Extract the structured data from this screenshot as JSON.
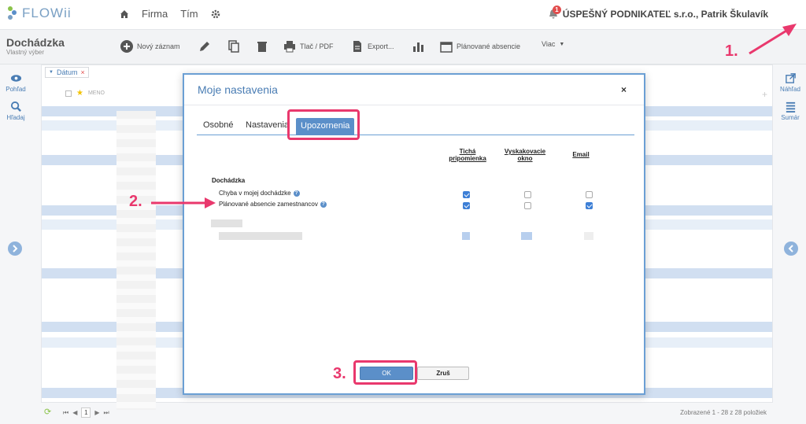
{
  "app": {
    "name": "FLOWii"
  },
  "nav": {
    "items": [
      "Firma",
      "Tím"
    ]
  },
  "header": {
    "company": "ÚSPEŠNÝ PODNIKATEĽ s.r.o., Patrik Škulavík",
    "notification_count": "1"
  },
  "page": {
    "title": "Dochádzka",
    "subtitle": "Vlastný výber"
  },
  "toolbar": {
    "new_record": "Nový záznam",
    "print": "Tlač / PDF",
    "export": "Export...",
    "planned_absences": "Plánované absencie",
    "more": "Viac"
  },
  "leftnav": {
    "view": "Pohľad",
    "search": "Hľadaj"
  },
  "rightnav": {
    "preview": "Náhľad",
    "summary": "Sumár"
  },
  "grid": {
    "filter_chip": "Dátum",
    "name_column": "MENO"
  },
  "footer": {
    "page": "1",
    "count_text": "Zobrazené 1 - 28 z 28 položiek"
  },
  "dialog": {
    "title": "Moje nastavenia",
    "close": "×",
    "tabs": [
      {
        "label": "Osobné",
        "active": false
      },
      {
        "label": "Nastavenia",
        "active": false
      },
      {
        "label": "Upozornenia",
        "active": true
      }
    ],
    "columns": [
      "Tichá\npripomienka",
      "Vyskakovacie\nokno",
      "Email"
    ],
    "section": "Dochádzka",
    "rows": [
      {
        "label": "Chyba v mojej dochádzke",
        "silent": true,
        "popup": false,
        "email": false
      },
      {
        "label": "Plánované absencie zamestnancov",
        "silent": true,
        "popup": false,
        "email": true
      }
    ],
    "ok_label": "OK",
    "cancel_label": "Zruš"
  },
  "annotations": {
    "step1": "1.",
    "step2": "2.",
    "step3": "3."
  },
  "colors": {
    "accent": "#5b8fc9",
    "highlight": "#e9386d"
  }
}
